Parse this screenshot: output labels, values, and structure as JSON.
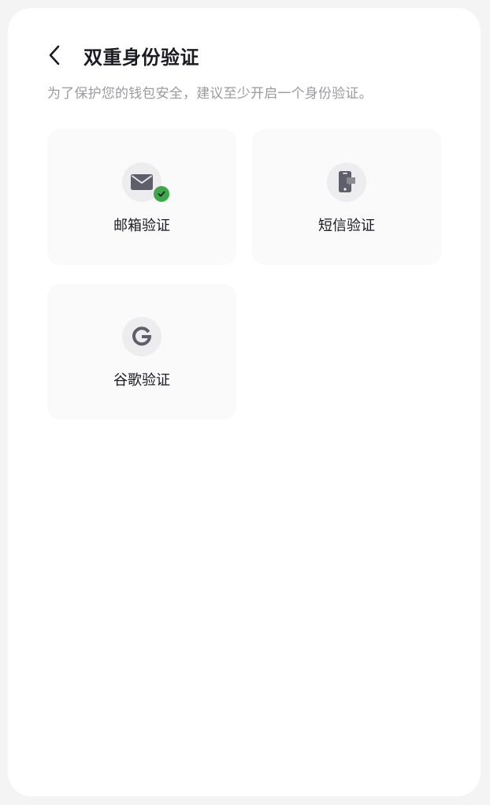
{
  "header": {
    "title": "双重身份验证"
  },
  "subtitle": "为了保护您的钱包安全，建议至少开启一个身份验证。",
  "options": [
    {
      "label": "邮箱验证",
      "icon": "mail-icon",
      "verified": true
    },
    {
      "label": "短信验证",
      "icon": "phone-message-icon",
      "verified": false
    },
    {
      "label": "谷歌验证",
      "icon": "google-icon",
      "verified": false
    }
  ],
  "colors": {
    "verified_badge": "#3da84a",
    "icon_fill": "#5f5f6b",
    "title_text": "#1b1b23",
    "subtitle_text": "#9a9aa1"
  }
}
